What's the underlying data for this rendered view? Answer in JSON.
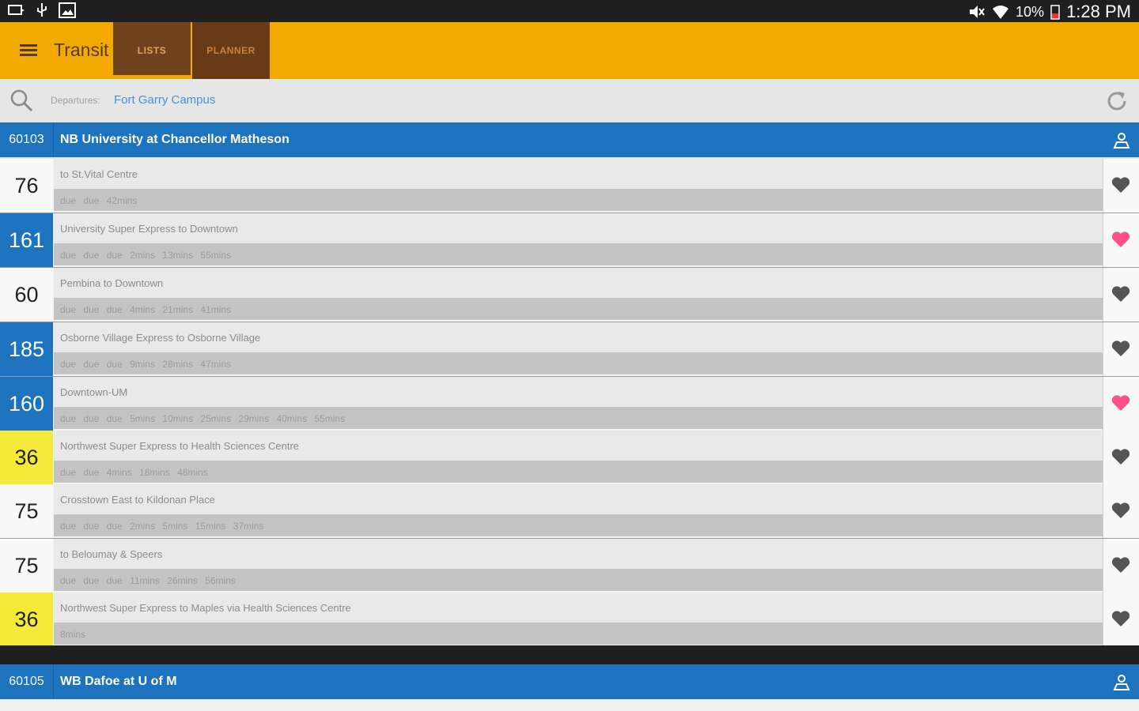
{
  "status_bar": {
    "battery": "10%",
    "time": "1:28 PM"
  },
  "app_bar": {
    "title": "Transit",
    "tabs": [
      {
        "label": "LISTS",
        "active": true
      },
      {
        "label": "PLANNER",
        "active": false
      }
    ]
  },
  "search": {
    "label": "Departures:",
    "value": "Fort Garry Campus"
  },
  "colors": {
    "accent": "#f2a900",
    "stop_header": "#1e73be",
    "favorite_on": "#ff4f8b",
    "favorite_off": "#555555"
  },
  "stops": [
    {
      "id": "60103",
      "name": "NB University at Chancellor Matheson",
      "routes": [
        {
          "number": "76",
          "style": "white",
          "destination": "to St.Vital Centre",
          "times": "due due 42mins",
          "favorite": false
        },
        {
          "number": "161",
          "style": "blue",
          "destination": "University Super Express to Downtown",
          "times": "due due due 2mins 13mins 55mins",
          "favorite": true
        },
        {
          "number": "60",
          "style": "white",
          "destination": "Pembina to Downtown",
          "times": "due due due 4mins 21mins 41mins",
          "favorite": false
        },
        {
          "number": "185",
          "style": "blue",
          "destination": "Osborne Village Express to Osborne Village",
          "times": "due due due 9mins 28mins 47mins",
          "favorite": false
        },
        {
          "number": "160",
          "style": "blue",
          "destination": "Downtown-UM",
          "times": "due due due 5mins 10mins 25mins 29mins 40mins 55mins",
          "favorite": true
        },
        {
          "number": "36",
          "style": "yellow",
          "destination": "Northwest Super Express to Health Sciences Centre",
          "times": "due due 4mins 18mins 48mins",
          "favorite": false
        },
        {
          "number": "75",
          "style": "white",
          "destination": "Crosstown East to Kildonan Place",
          "times": "due due due 2mins 5mins 15mins 37mins",
          "favorite": false
        },
        {
          "number": "75",
          "style": "white",
          "destination": "to Beloumay & Speers",
          "times": "due due due 11mins 26mins 56mins",
          "favorite": false
        },
        {
          "number": "36",
          "style": "yellow",
          "destination": "Northwest Super Express to Maples via Health Sciences Centre",
          "times": "8mins",
          "favorite": false
        }
      ]
    },
    {
      "id": "60105",
      "name": "WB Dafoe at U of M",
      "routes": []
    }
  ]
}
